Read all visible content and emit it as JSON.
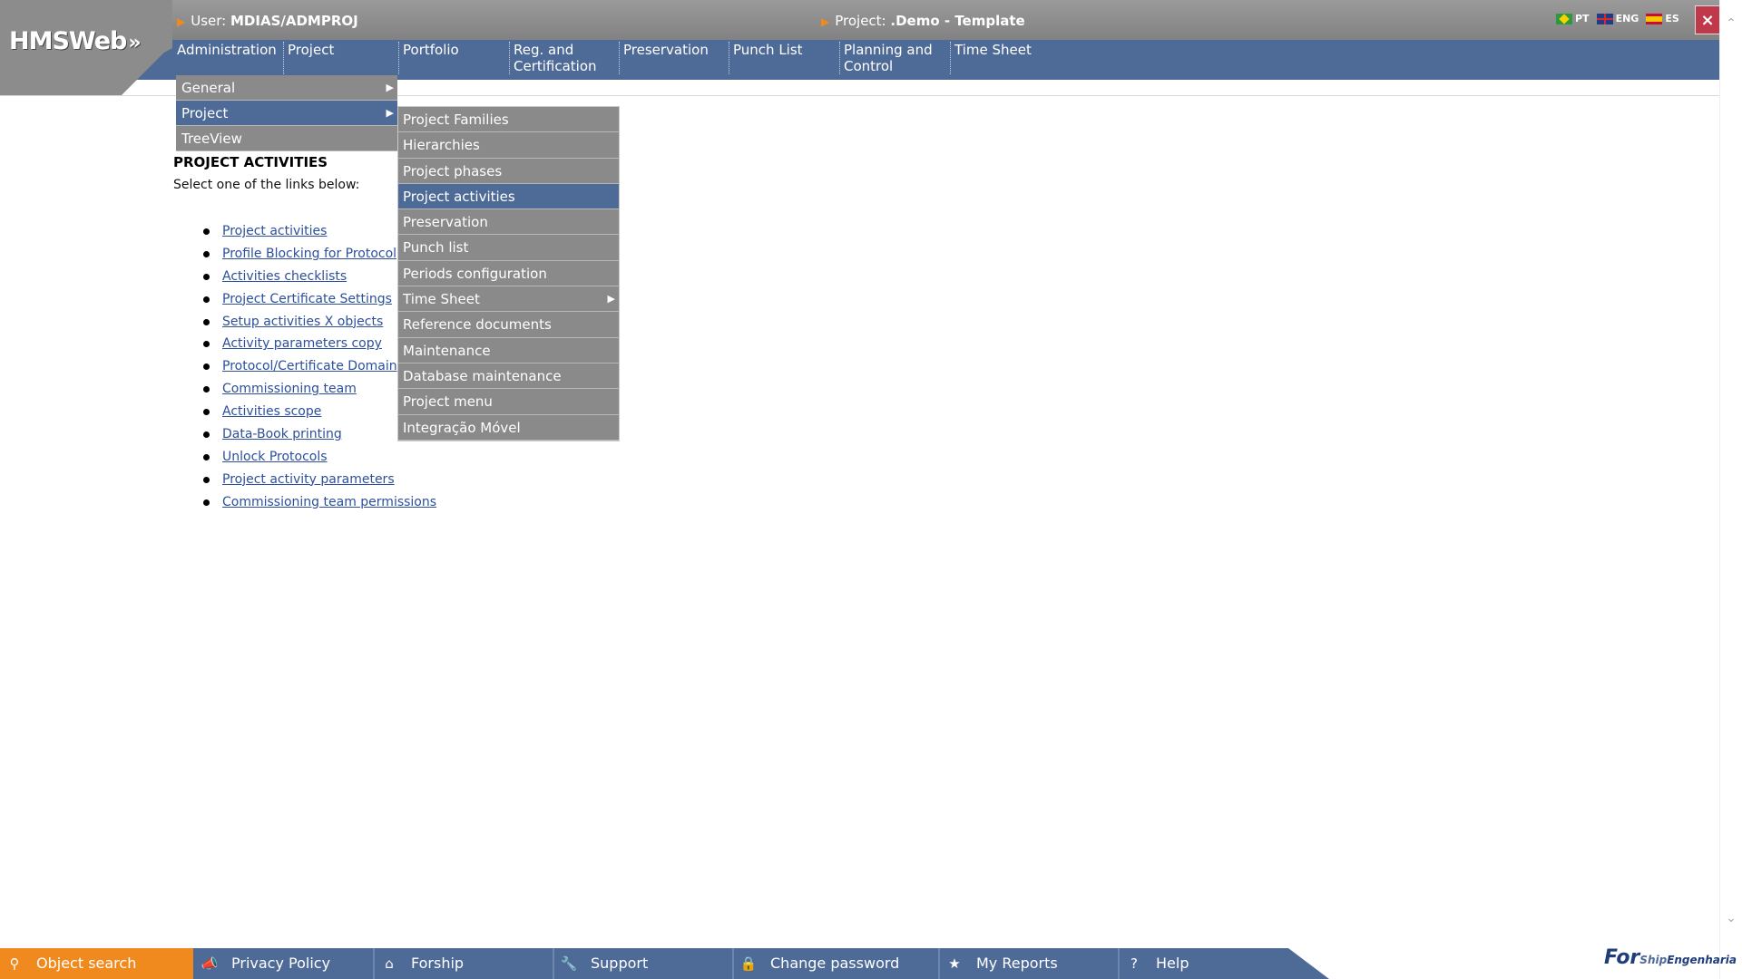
{
  "header": {
    "logo": "HMSWeb",
    "logo_arrows": "»",
    "user_label": "User:",
    "user_value": "MDIAS/ADMPROJ",
    "project_label": "Project:",
    "project_value": ".Demo - Template",
    "close_label": "×",
    "languages": [
      {
        "code": "PT",
        "flag": "flag-br"
      },
      {
        "code": "ENG",
        "flag": "flag-gb"
      },
      {
        "code": "ES",
        "flag": "flag-es"
      }
    ]
  },
  "nav": {
    "items": [
      {
        "label": "Administration"
      },
      {
        "label": "Project"
      },
      {
        "label": "Portfolio"
      },
      {
        "label": "Reg. and",
        "label2": "Certification"
      },
      {
        "label": "Preservation"
      },
      {
        "label": "Punch List"
      },
      {
        "label": "Planning and",
        "label2": "Control"
      },
      {
        "label": "Time Sheet"
      }
    ]
  },
  "menu_level1": {
    "items": [
      {
        "label": "General",
        "has_submenu": true,
        "active": false
      },
      {
        "label": "Project",
        "has_submenu": true,
        "active": true
      },
      {
        "label": "TreeView",
        "has_submenu": false,
        "active": false
      }
    ]
  },
  "menu_level2": {
    "items": [
      {
        "label": "Project Families"
      },
      {
        "label": "Hierarchies"
      },
      {
        "label": "Project phases"
      },
      {
        "label": "Project activities",
        "active": true
      },
      {
        "label": "Preservation"
      },
      {
        "label": "Punch list"
      },
      {
        "label": "Periods configuration"
      },
      {
        "label": "Time Sheet",
        "has_submenu": true
      },
      {
        "label": "Reference documents"
      },
      {
        "label": "Maintenance"
      },
      {
        "label": "Database maintenance"
      },
      {
        "label": "Project menu"
      },
      {
        "label": "Integração Móvel"
      }
    ]
  },
  "content": {
    "title": "PROJECT ACTIVITIES",
    "subtitle": "Select one of the links below:",
    "links": [
      "Project activities",
      "Profile Blocking for Protocol",
      "Activities checklists",
      "Project Certificate Settings",
      "Setup activities X objects",
      "Activity parameters copy",
      "Protocol/Certificate Domain",
      "Commissioning team",
      "Activities scope",
      "Data-Book printing",
      "Unlock Protocols",
      "Project activity parameters",
      "Commissioning team permissions"
    ]
  },
  "footer": {
    "items": [
      {
        "label": "Object search",
        "icon": "search-icon"
      },
      {
        "label": "Privacy Policy",
        "icon": "megaphone-icon"
      },
      {
        "label": "Forship",
        "icon": "home-icon"
      },
      {
        "label": "Support",
        "icon": "wrench-icon"
      },
      {
        "label": "Change password",
        "icon": "lock-icon"
      },
      {
        "label": "My Reports",
        "icon": "star-icon"
      },
      {
        "label": "Help",
        "icon": "question-icon"
      }
    ],
    "brand_for": "For",
    "brand_ship": "Ship",
    "brand_eng": "Engenharia"
  },
  "colors": {
    "nav_blue": "#4e6b97",
    "header_gray": "#8a8a8a",
    "accent_orange": "#f18a1e",
    "close_red": "#c0394b",
    "link_blue": "#2c4f9c"
  }
}
